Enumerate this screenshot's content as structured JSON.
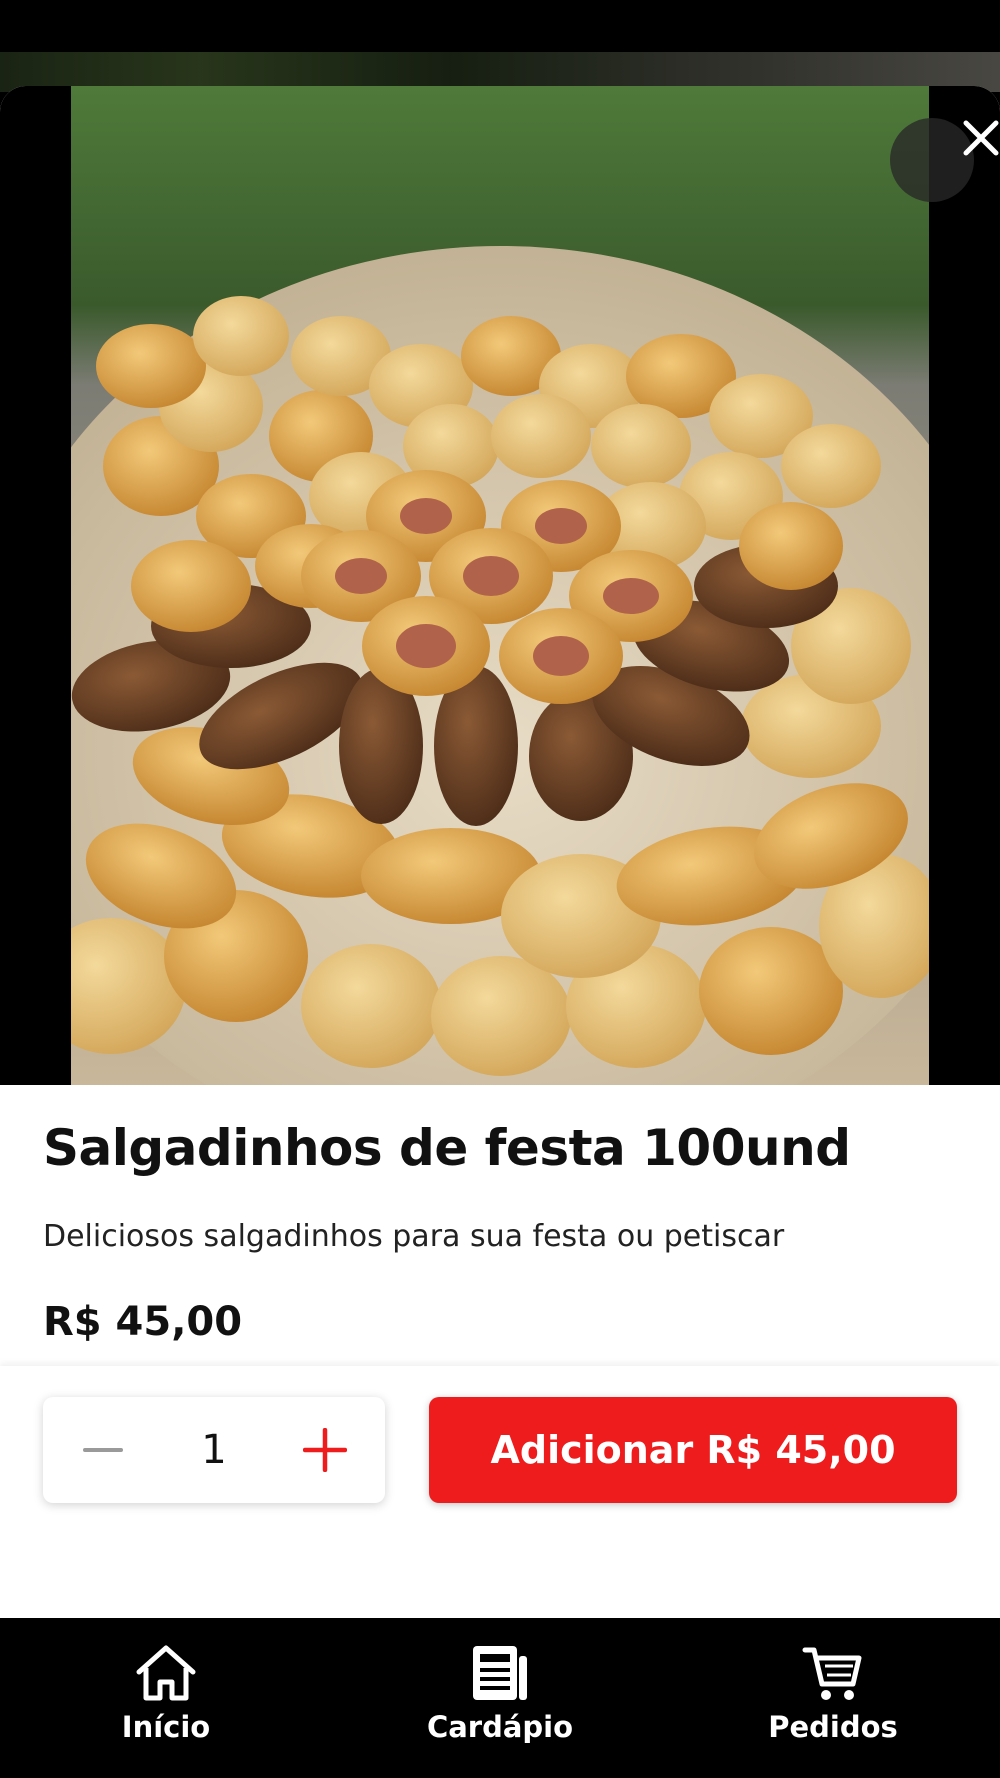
{
  "product": {
    "title": "Salgadinhos de festa 100und",
    "description": "Deliciosos salgadinhos para sua festa ou petiscar",
    "price": "R$ 45,00"
  },
  "order": {
    "quantity": "1",
    "add_button_label": "Adicionar R$ 45,00"
  },
  "bottom_nav": {
    "items": [
      {
        "label": "Início",
        "icon": "home-icon"
      },
      {
        "label": "Cardápio",
        "icon": "menu-newspaper-icon"
      },
      {
        "label": "Pedidos",
        "icon": "cart-icon"
      }
    ]
  },
  "colors": {
    "accent": "#ee1c1c",
    "nav_background": "#000000"
  }
}
